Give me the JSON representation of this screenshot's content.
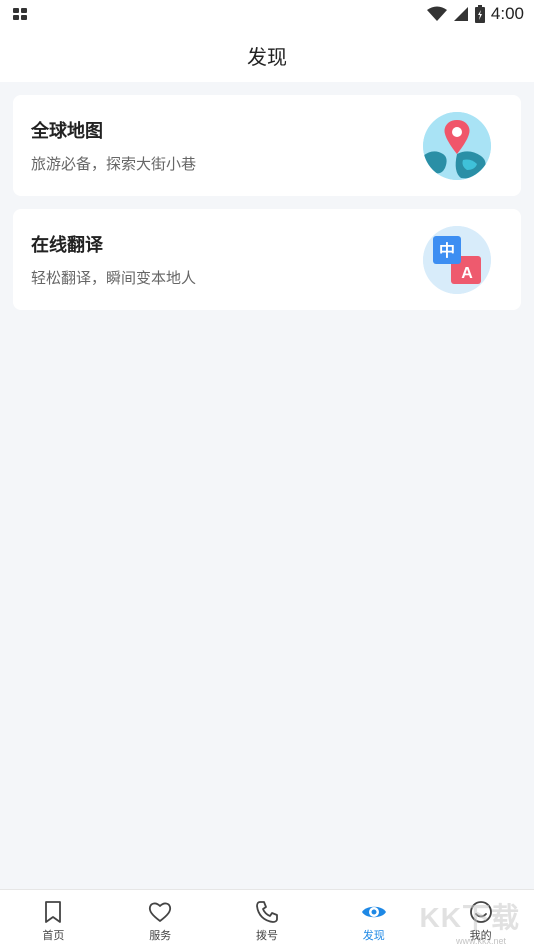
{
  "status_bar": {
    "time": "4:00"
  },
  "header": {
    "title": "发现"
  },
  "cards": [
    {
      "title": "全球地图",
      "subtitle": "旅游必备，探索大街小巷",
      "icon": "globe-pin-icon"
    },
    {
      "title": "在线翻译",
      "subtitle": "轻松翻译，瞬间变本地人",
      "icon": "translate-icon",
      "icon_glyphs": [
        "中",
        "A"
      ]
    }
  ],
  "tabbar": {
    "active": "发现",
    "active_color": "#1e88e5",
    "items": [
      {
        "label": "首页",
        "icon": "bookmark-icon"
      },
      {
        "label": "服务",
        "icon": "heart-icon"
      },
      {
        "label": "拨号",
        "icon": "phone-icon"
      },
      {
        "label": "发现",
        "icon": "eye-icon"
      },
      {
        "label": "我的",
        "icon": "smiley-icon"
      }
    ]
  },
  "watermark": {
    "brand": "KK下载",
    "url": "www.kkx.net"
  }
}
